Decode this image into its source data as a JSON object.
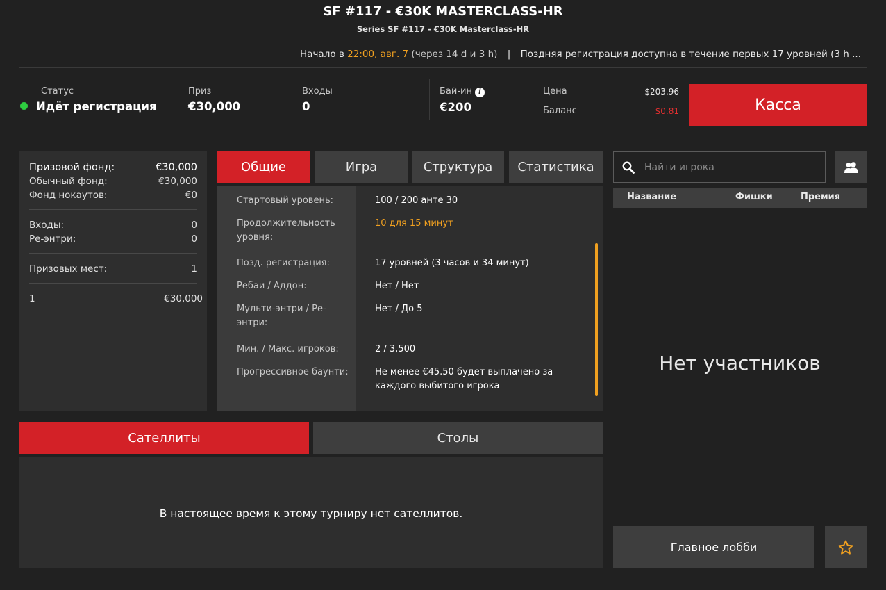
{
  "header": {
    "title": "SF #117 - €30K MASTERCLASS-HR",
    "subtitle": "Series SF #117 - €30K Masterclass-HR",
    "start_prefix": "Начало в",
    "start_time": "22:00, авг. 7",
    "start_relative": "(через 14 d и 3 h)",
    "separator": "|",
    "late_reg": "Поздняя регистрация доступна в течение первых 17 уровней (3 h ..."
  },
  "info": {
    "status_label": "Статус",
    "status_value": "Идёт регистрация",
    "prize_label": "Приз",
    "prize_value": "€30,000",
    "entries_label": "Входы",
    "entries_value": "0",
    "buyin_label": "Бай-ин",
    "buyin_value": "€200",
    "price_label": "Цена",
    "price_value": "$203.96",
    "balance_label": "Баланс",
    "balance_value": "$0.81",
    "cashier_label": "Касса"
  },
  "colors": {
    "accent_red": "#d32127",
    "status_green": "#2ecc40",
    "highlight_orange": "#f0a020",
    "balance_red": "#e53030"
  },
  "left_panel": {
    "prize_pool_label": "Призовой фонд:",
    "prize_pool_value": "€30,000",
    "regular_pool_label": "Обычный фонд:",
    "regular_pool_value": "€30,000",
    "knockout_pool_label": "Фонд нокаутов:",
    "knockout_pool_value": "€0",
    "entries_label": "Входы:",
    "entries_value": "0",
    "reentries_label": "Ре-энтри:",
    "reentries_value": "0",
    "paid_places_label": "Призовых мест:",
    "paid_places_value": "1",
    "payouts": [
      {
        "place": "1",
        "amount": "€30,000"
      }
    ]
  },
  "tabs": [
    {
      "label": "Общие"
    },
    {
      "label": "Игра"
    },
    {
      "label": "Структура"
    },
    {
      "label": "Статистика"
    }
  ],
  "details": [
    {
      "label": "Стартовый уровень:",
      "value": "100 / 200 анте 30"
    },
    {
      "label": "Продолжительность уровня:",
      "value": "10 для 15 минут"
    },
    {
      "label": "Позд. регистрация:",
      "value": "17 уровней (3 часов и 34 минут)"
    },
    {
      "label": "Ребаи / Аддон:",
      "value": "Нет / Нет"
    },
    {
      "label": "Мульти-энтри / Ре-энтри:",
      "value": "Нет / До 5"
    },
    {
      "label": "Мин. / Макс. игроков:",
      "value": "2 / 3,500"
    },
    {
      "label": "Прогрессивное баунти:",
      "value": "Не менее €45.50 будет выплачено за каждого выбитого игрока"
    }
  ],
  "bottom_tabs": [
    {
      "label": "Сателлиты"
    },
    {
      "label": "Столы"
    }
  ],
  "satellites_message": "В настоящее время к этому турниру нет сателлитов.",
  "players": {
    "search_placeholder": "Найти игрока",
    "col_name": "Название",
    "col_chips": "Фишки",
    "col_prize": "Премия",
    "empty_message": "Нет участников"
  },
  "footer": {
    "main_lobby_label": "Главное лобби"
  },
  "icons": {
    "search": "search-icon",
    "players": "players-icon",
    "star": "star-icon",
    "info": "info-icon"
  }
}
